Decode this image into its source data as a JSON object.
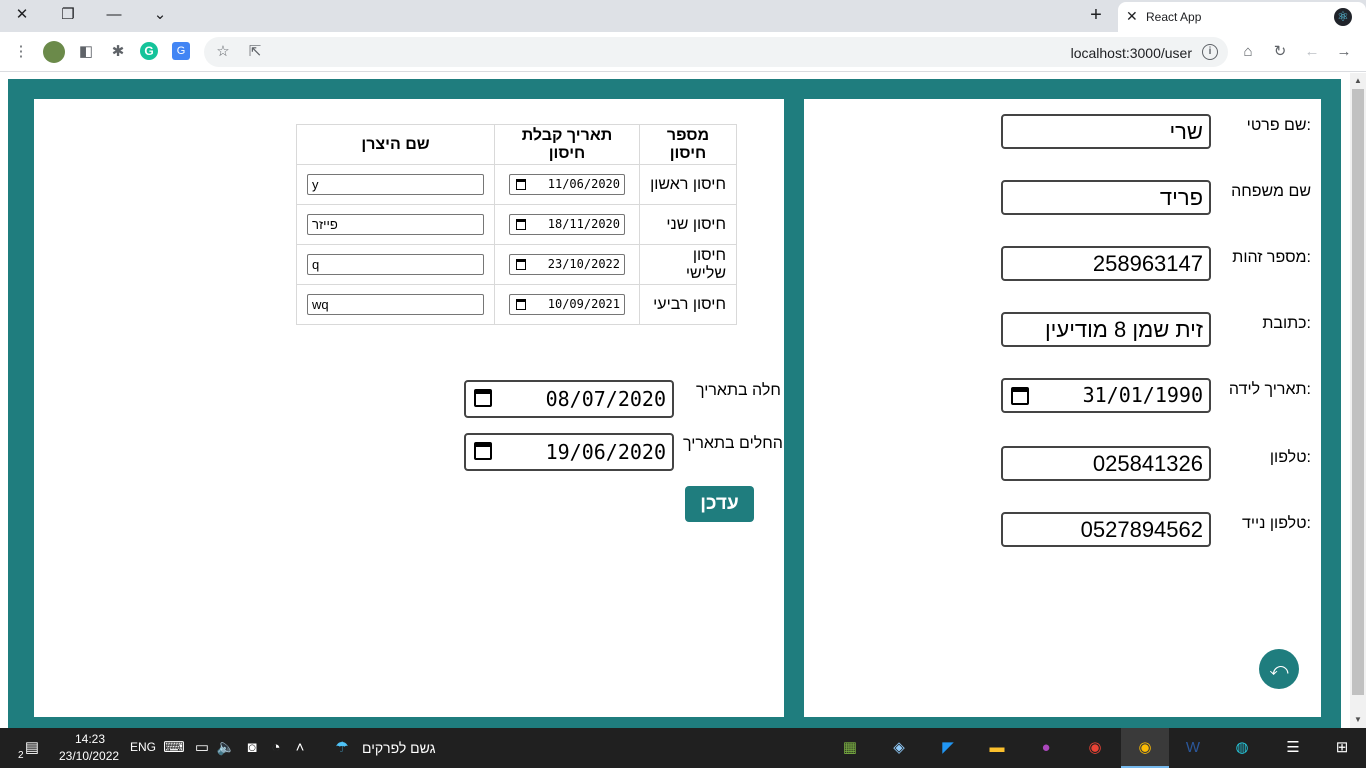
{
  "browser": {
    "tab_title": "React App",
    "url": "localhost:3000/user",
    "new_tab_label": "+",
    "window_controls": {
      "close": "✕",
      "restore": "❐",
      "minimize": "—",
      "dropdown": "⌄"
    }
  },
  "personal_form": {
    "fields": [
      {
        "label": ":שם פרטי",
        "value": "שרי"
      },
      {
        "label": "שם משפחה",
        "value": "פריד"
      },
      {
        "label": ":מספר זהות",
        "value": "258963147"
      },
      {
        "label": ":כתובת",
        "value": "זית שמן 8 מודיעין"
      },
      {
        "label": ":תאריך לידה",
        "value": "31/01/1990"
      },
      {
        "label": ":טלפון",
        "value": "025841326"
      },
      {
        "label": ":טלפון נייד",
        "value": "0527894562"
      }
    ],
    "back_icon": "undo-icon",
    "back_glyph": "⤺"
  },
  "vaccinations": {
    "headers": [
      "מספר חיסון",
      "תאריך קבלת חיסון",
      "שם היצרן"
    ],
    "rows": [
      {
        "name": "חיסון ראשון",
        "date": "11/06/2020",
        "maker": "y"
      },
      {
        "name": "חיסון שני",
        "date": "18/11/2020",
        "maker": "פייזר"
      },
      {
        "name": "חיסון שלישי",
        "date": "23/10/2022",
        "maker": "q"
      },
      {
        "name": "חיסון רביעי",
        "date": "10/09/2021",
        "maker": "wq"
      }
    ]
  },
  "illness": {
    "sick_label": "חלה בתאריך",
    "sick_date": "08/07/2020",
    "recovered_label": "החלים בתאריך",
    "recovered_date": "19/06/2020",
    "update_button": "עדכן"
  },
  "taskbar": {
    "time": "14:23",
    "date": "23/10/2022",
    "language": "ENG",
    "weather_text": "גשם לפרקים",
    "notification_count": "2"
  }
}
